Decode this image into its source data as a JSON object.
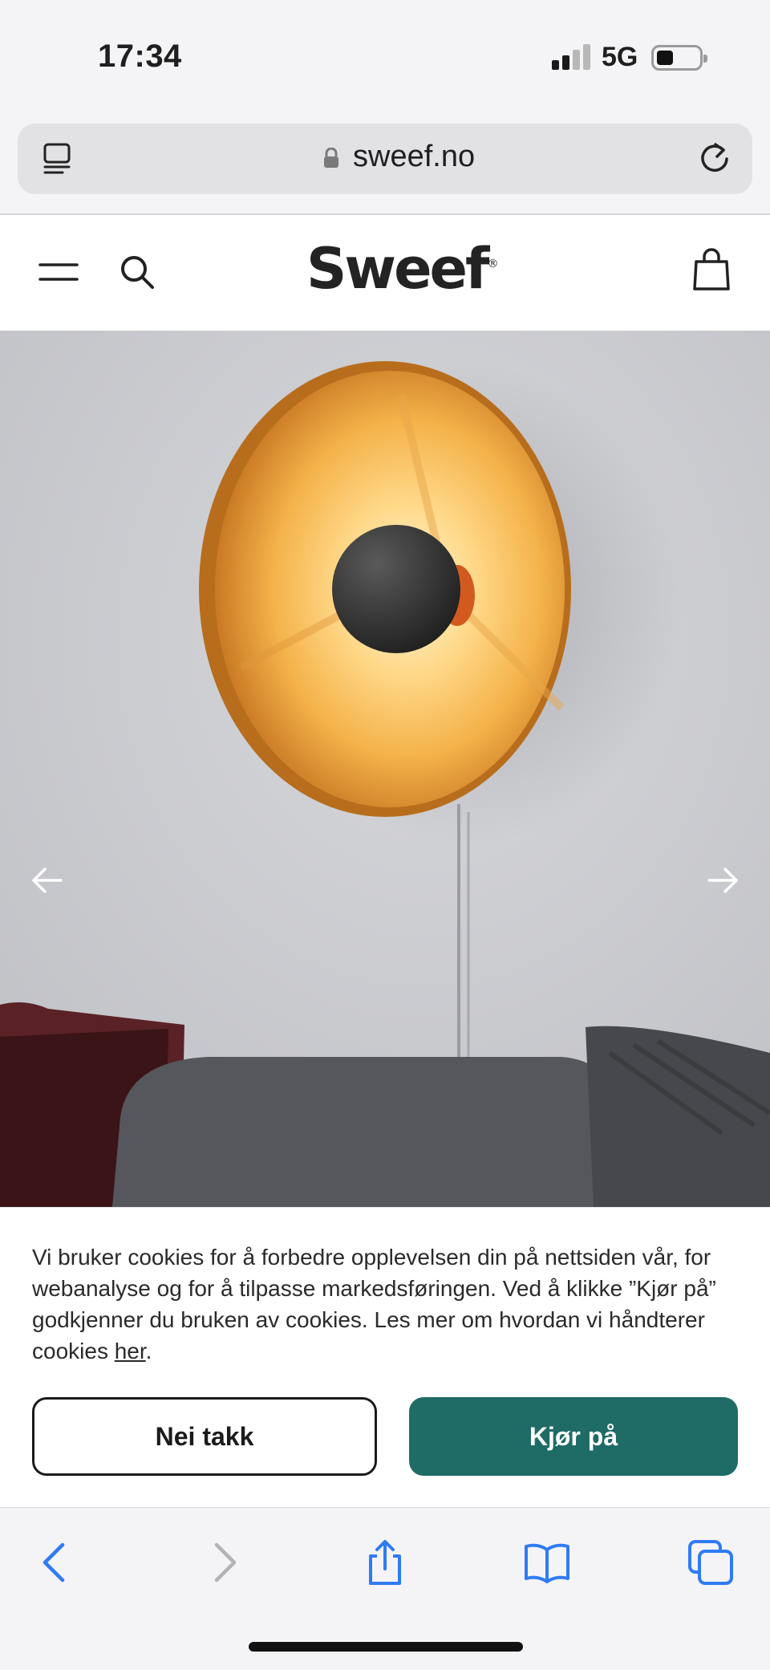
{
  "status_bar": {
    "time": "17:34",
    "network": "5G",
    "battery_icon": "battery-low-icon",
    "signal_icon": "cellular-signal-icon"
  },
  "browser": {
    "url": "sweef.no",
    "reader_icon": "reader-view-icon",
    "lock_icon": "lock-icon",
    "reload_icon": "reload-icon"
  },
  "site_header": {
    "logo": "Sweef",
    "logo_mark": "®",
    "menu_icon": "hamburger-menu-icon",
    "search_icon": "search-icon",
    "cart_icon": "shopping-bag-icon"
  },
  "hero": {
    "image_subject": "Round gold wall lamp above grey sofa",
    "prev_icon": "arrow-left-icon",
    "next_icon": "arrow-right-icon"
  },
  "cookie_banner": {
    "text": "Vi bruker cookies for å forbedre opplevelsen din på nettsiden vår, for webanalyse og for å tilpasse markedsføringen. Ved å klikke ”Kjør på” godkjenner du bruken av cookies. Les mer om hvordan vi håndterer cookies",
    "link_text": "her",
    "period": ".",
    "decline_label": "Nei takk",
    "accept_label": "Kjør på",
    "accept_color": "#1f6b66"
  },
  "toolbar": {
    "back_icon": "back-chevron-icon",
    "forward_icon": "forward-chevron-icon",
    "share_icon": "share-icon",
    "bookmarks_icon": "bookmarks-book-icon",
    "tabs_icon": "tabs-icon",
    "accent": "#2f7bf5"
  }
}
